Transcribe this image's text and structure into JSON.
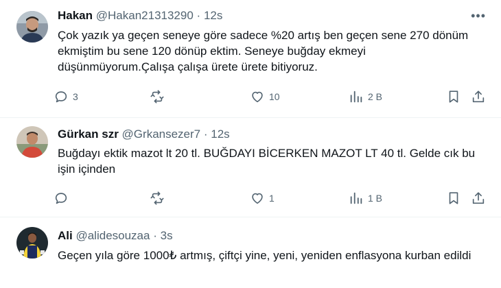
{
  "tweets": [
    {
      "name": "Hakan",
      "handle": "@Hakan21313290",
      "separator": "·",
      "time": "12s",
      "text": "Çok yazık ya geçen seneye göre sadece %20 artış ben geçen sene 270 dönüm ekmiştim bu sene 120 dönüp ektim. Seneye buğday ekmeyi düşünmüyorum.Çalışa çalışa ürete ürete bitiyoruz.",
      "replies": "3",
      "retweets": "",
      "likes": "10",
      "views": "2 B"
    },
    {
      "name": "Gürkan szr",
      "handle": "@Grkansezer7",
      "separator": "·",
      "time": "12s",
      "text": "Buğdayı ektik mazot lt 20 tl. BUĞDAYI BİCERKEN MAZOT LT 40 tl. Gelde cık bu işin içinden",
      "replies": "",
      "retweets": "",
      "likes": "1",
      "views": "1 B"
    },
    {
      "name": "Ali",
      "handle": "@alidesouzaa",
      "separator": "·",
      "time": "3s",
      "text": "Geçen yıla göre 1000₺ artmış, çiftçi yine, yeni, yeniden enflasyona kurban edildi"
    }
  ],
  "icons": {
    "more": "more-icon",
    "reply": "reply-icon",
    "retweet": "retweet-icon",
    "like": "heart-icon",
    "views": "views-icon",
    "bookmark": "bookmark-icon",
    "share": "share-icon"
  },
  "colors": {
    "text": "#0f1419",
    "muted": "#536471",
    "divider": "#eff3f4"
  }
}
